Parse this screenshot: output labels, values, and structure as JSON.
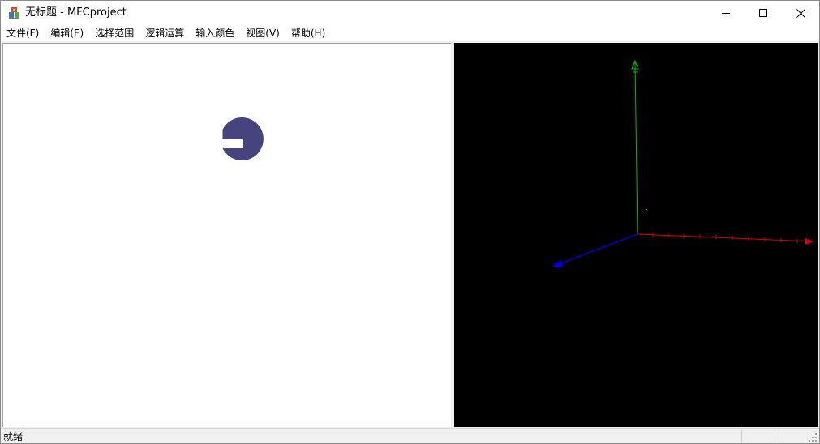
{
  "window": {
    "title": "无标题 - MFCproject",
    "buttons": {
      "minimize": "minimize-icon",
      "maximize": "maximize-icon",
      "close": "close-icon"
    }
  },
  "menu": [
    {
      "label": "文件(F)"
    },
    {
      "label": "编辑(E)"
    },
    {
      "label": "选择范围"
    },
    {
      "label": "逻辑运算"
    },
    {
      "label": "输入颜色"
    },
    {
      "label": "视图(V)"
    },
    {
      "label": "帮助(H)"
    }
  ],
  "left_view": {
    "shape_color": "#45447f"
  },
  "right_view": {
    "background": "#000000",
    "axis_colors": {
      "x": "#e00000",
      "y": "#00c000",
      "z": "#0000e0"
    }
  },
  "status": {
    "text": "就绪"
  }
}
